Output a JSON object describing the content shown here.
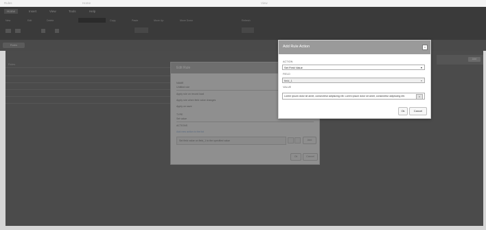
{
  "window": {
    "title_segments": [
      "Rules",
      "Home",
      "View"
    ]
  },
  "ribbon": {
    "tabs": [
      "Home",
      "Insert",
      "View",
      "Tools",
      "Help"
    ],
    "buttons": [
      "New",
      "Edit",
      "Delete",
      "Copy",
      "Paste",
      "Move Up",
      "Move Down",
      "Refresh"
    ]
  },
  "subheader": {
    "pill": "Rules"
  },
  "list": {
    "rows": [
      "Rules",
      "",
      "",
      "",
      "",
      ""
    ]
  },
  "right_panel": {
    "button": "Add"
  },
  "edit_rule_dialog": {
    "title": "Edit Rule",
    "name_label": "NAME",
    "name_value": "Untitled rule",
    "options": [
      "Apply rule on record load",
      "Apply rule when field value changes",
      "Apply on save"
    ],
    "type_label": "TYPE",
    "type_value": "Set value",
    "actions_label": "ACTIONS",
    "link_text": "Add new action to the list",
    "action_row": "Set field value on field_1 to the specified value",
    "add_button": "Add",
    "ok_button": "Ok",
    "cancel_button": "Cancel"
  },
  "add_rule_action": {
    "title": "Add Rule Action",
    "close_glyph": "×",
    "action_label": "ACTION",
    "action_value": "Set Field Value",
    "field_label": "FIELD",
    "field_value": "field_1",
    "value_label": "VALUE",
    "value_text": "Lorem ipsum dolor sit amet, consectetur adipiscing elit. Lorem ipsum dolor sit amet, consectetur adipiscing elit.",
    "value_clear": "×",
    "ok_button": "Ok",
    "cancel_button": "Cancel",
    "caret_glyph": "▾"
  }
}
